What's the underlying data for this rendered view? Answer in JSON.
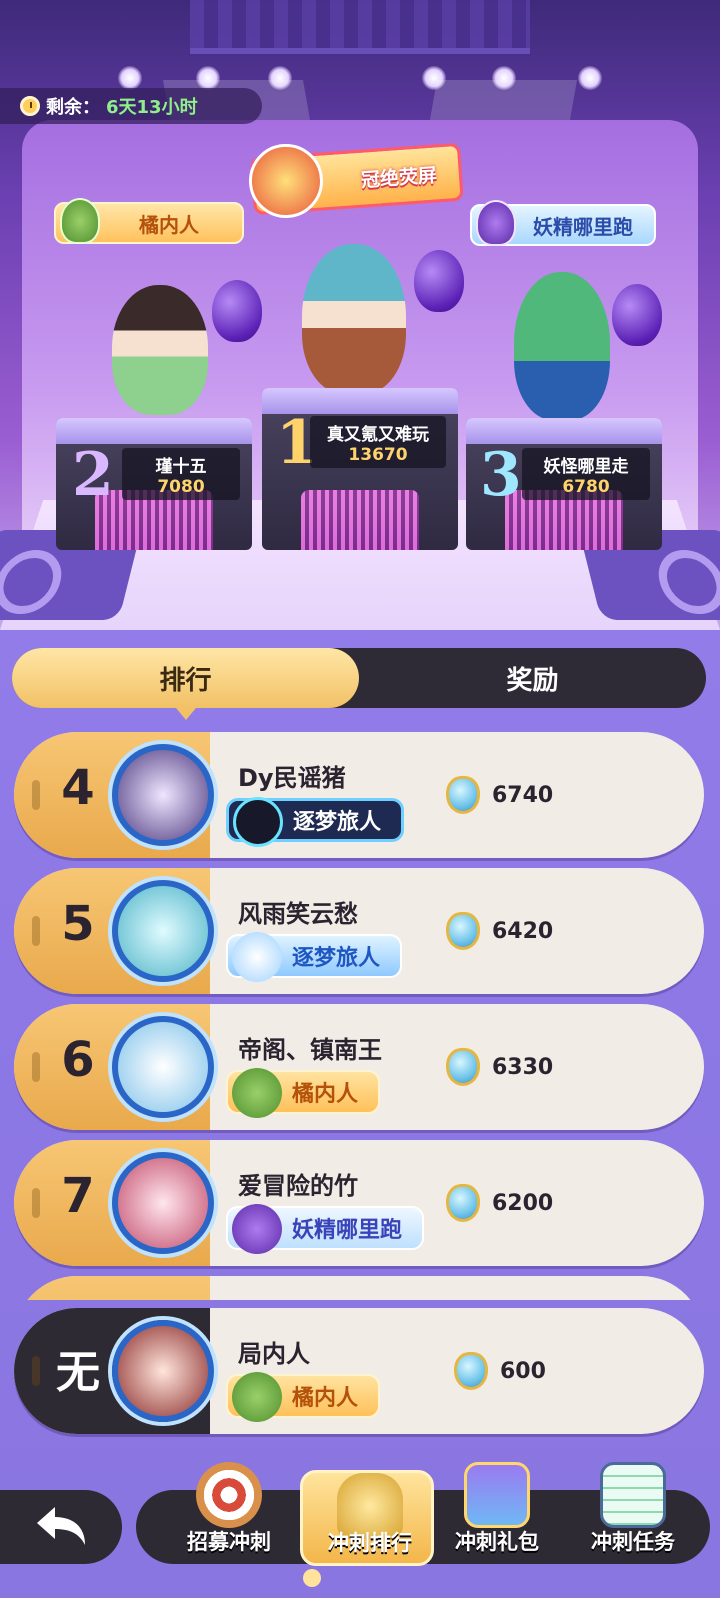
{
  "timer": {
    "label": "剩余：",
    "value": "6天13小时"
  },
  "stage": {
    "title": "冠绝荧屏",
    "left_tag": "橘内人",
    "right_tag": "妖精哪里跑",
    "podium": [
      {
        "rank": "2",
        "name": "瑾十五",
        "score": "7080"
      },
      {
        "rank": "1",
        "name": "真又氪又难玩",
        "score": "13670"
      },
      {
        "rank": "3",
        "name": "妖怪哪里走",
        "score": "6780"
      }
    ]
  },
  "tabs": [
    {
      "label": "排行"
    },
    {
      "label": "奖励"
    }
  ],
  "ranking": [
    {
      "rank": "4",
      "name": "Dy民谣猪",
      "badge": "逐梦旅人",
      "score": "6740"
    },
    {
      "rank": "5",
      "name": "风雨笑云愁",
      "badge": "逐梦旅人",
      "score": "6420"
    },
    {
      "rank": "6",
      "name": "帝阁、镇南王",
      "badge": "橘内人",
      "score": "6330"
    },
    {
      "rank": "7",
      "name": "爱冒险的竹",
      "badge": "妖精哪里跑",
      "score": "6200"
    }
  ],
  "me": {
    "rank": "无",
    "name": "局内人",
    "badge": "橘内人",
    "score": "600"
  },
  "nav": [
    {
      "label": "招募冲刺",
      "icon": "dartboard-icon"
    },
    {
      "label": "冲刺排行",
      "icon": "trophy-icon"
    },
    {
      "label": "冲刺礼包",
      "icon": "gift-box-icon"
    },
    {
      "label": "冲刺任务",
      "icon": "clipboard-icon"
    }
  ],
  "colors": {
    "accent": "#f2c166",
    "dark": "#2e2a34",
    "background": "#8d78e6"
  }
}
